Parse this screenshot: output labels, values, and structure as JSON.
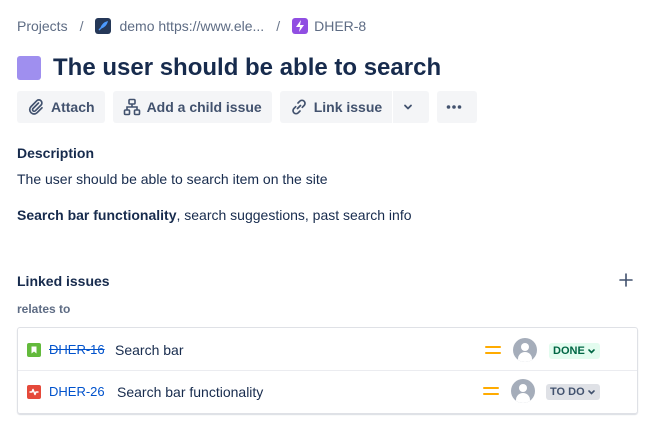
{
  "breadcrumb": {
    "projects": "Projects",
    "separator": "/",
    "project": "demo https://www.ele...",
    "epic_key": "DHER-8"
  },
  "issue": {
    "title": "The user should be able to search",
    "epic_color": "#9f8fef"
  },
  "toolbar": {
    "attach_label": "Attach",
    "child_label": "Add a child issue",
    "link_label": "Link issue",
    "attach_icon": "paperclip-icon",
    "child_icon": "hierarchy-icon",
    "link_icon": "link-icon"
  },
  "description": {
    "label": "Description",
    "line1": "The user should be able to search item on the site",
    "line2_bold": "Search bar functionality",
    "line2_rest": ", search suggestions, past search info"
  },
  "linked": {
    "label": "Linked issues",
    "relation": "relates to",
    "items": [
      {
        "key": "DHER-16",
        "summary": "Search bar",
        "type": "story",
        "type_color": "#63ba3c",
        "priority": "medium",
        "status": "DONE",
        "resolved": true
      },
      {
        "key": "DHER-26",
        "summary": "Search bar functionality",
        "type": "bug",
        "type_color": "#e5493a",
        "priority": "medium",
        "status": "TO DO",
        "resolved": false
      }
    ]
  },
  "colors": {
    "link": "#0052cc",
    "text": "#172b4d",
    "priority_medium": "#ffab00",
    "done_bg": "#e3fcef",
    "done_fg": "#006644",
    "todo_bg": "#dfe1e6"
  }
}
